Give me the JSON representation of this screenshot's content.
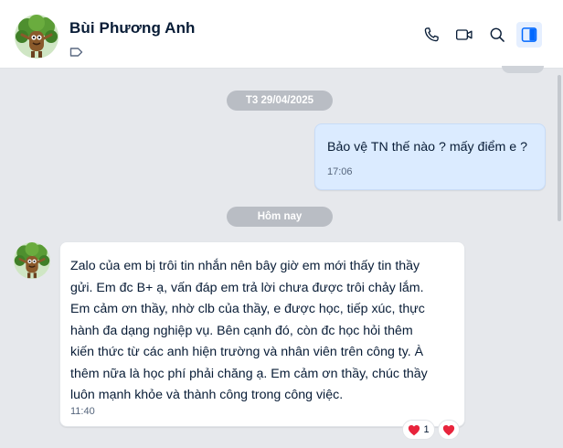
{
  "contact": {
    "name": "Bùi Phương Anh",
    "avatar_icon": "tree-character-avatar",
    "tag_icon": "label-tag-icon"
  },
  "header_actions": [
    {
      "icon": "phone-icon",
      "label": "Call"
    },
    {
      "icon": "video-camera-icon",
      "label": "Video call"
    },
    {
      "icon": "search-icon",
      "label": "Search"
    },
    {
      "icon": "sidebar-panel-icon",
      "label": "Conversation info",
      "active": true
    }
  ],
  "timeline": {
    "date_1": "T3 29/04/2025",
    "date_2": "Hôm nay"
  },
  "messages": {
    "outgoing_1": {
      "text": "Bảo vệ TN thế nào ? mấy điểm e ?",
      "time": "17:06"
    },
    "incoming_1": {
      "lines": [
        "Zalo của em bị trôi tin nhắn nên bây giờ em mới thấy tin thầy",
        "gửi. Em đc B+ ạ, vấn đáp em trả lời chưa được trôi chảy lắm.",
        "Em cảm ơn thầy, nhờ clb của thầy, e được học, tiếp xúc, thực",
        "hành đa dạng nghiệp vụ. Bên cạnh đó, còn đc học hỏi thêm",
        "kiến thức từ các anh hiện trường và nhân viên trên công ty. À",
        "thêm nữa là học phí phải chăng ạ. Em cảm ơn thầy, chúc thầy",
        "luôn mạnh khỏe và thành công trong công việc."
      ],
      "time": "11:40",
      "reactions": {
        "emoji": "❤️",
        "count": "1",
        "my_reaction": "❤️"
      }
    }
  },
  "colors": {
    "accent": "#0068ff",
    "outgoing_bubble": "#dbebff",
    "incoming_bubble": "#ffffff",
    "background": "#e6e8ec",
    "reaction_heart": "#e8243c"
  }
}
